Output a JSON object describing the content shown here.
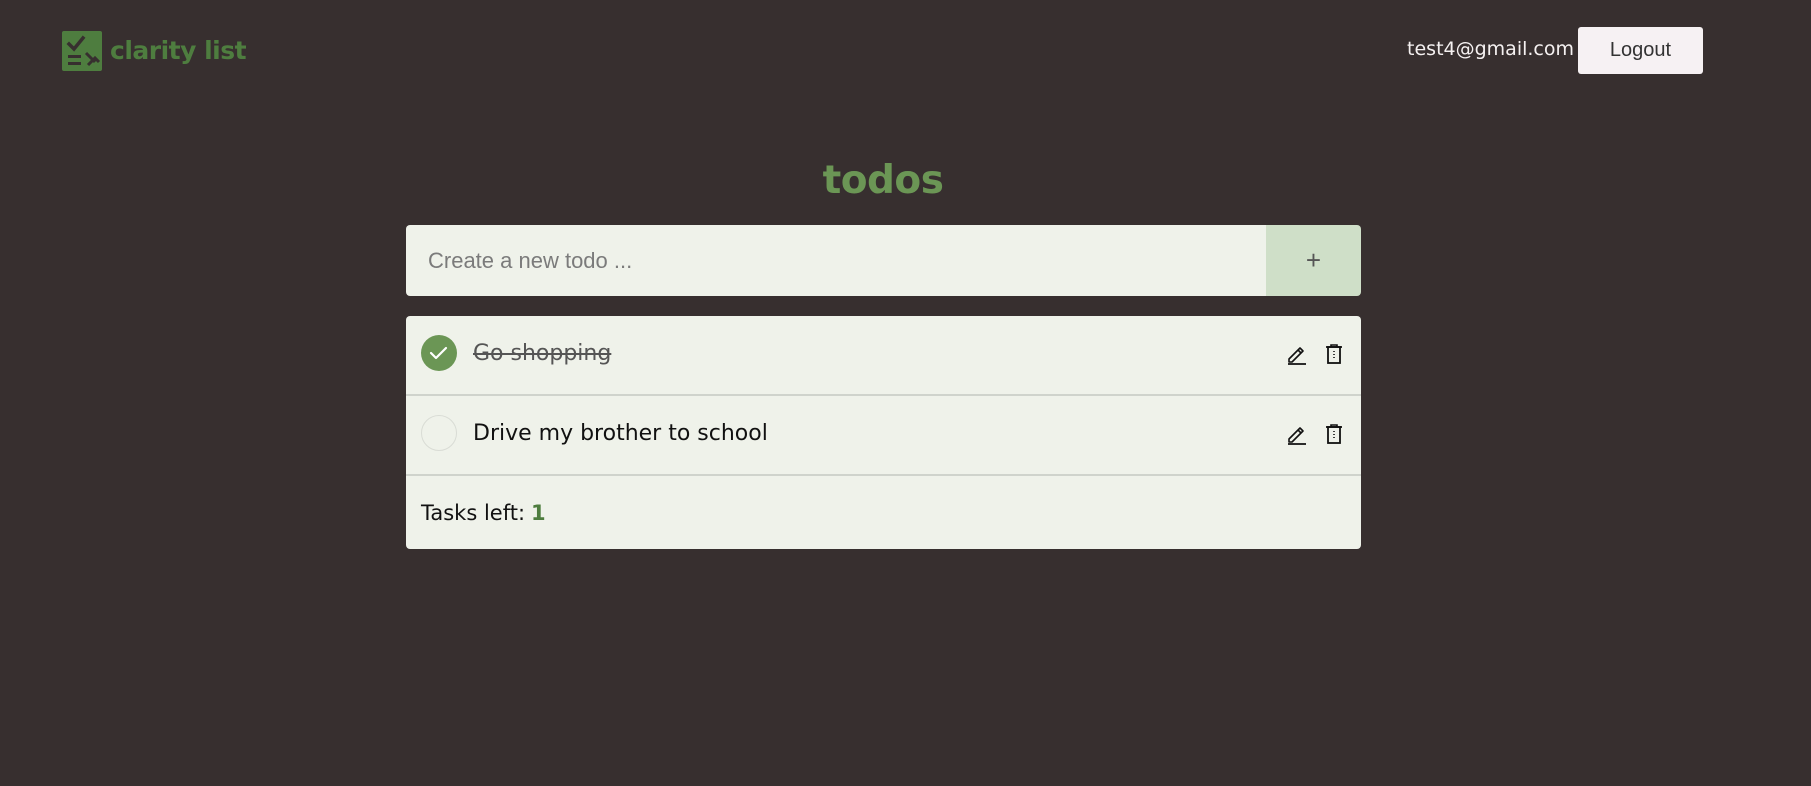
{
  "app": {
    "name": "clarity list",
    "accent_color": "#6b9655",
    "logo_icon": "checklist-icon"
  },
  "header": {
    "user_email": "test4@gmail.com",
    "logout_label": "Logout"
  },
  "main": {
    "title": "todos",
    "create_input": {
      "placeholder": "Create a new todo ...",
      "value": ""
    },
    "add_button_label": "+",
    "todos": [
      {
        "text": "Go shopping",
        "completed": true
      },
      {
        "text": "Drive my brother to school",
        "completed": false
      }
    ],
    "footer": {
      "tasks_left_label": "Tasks left:",
      "tasks_left_count": "1"
    }
  }
}
